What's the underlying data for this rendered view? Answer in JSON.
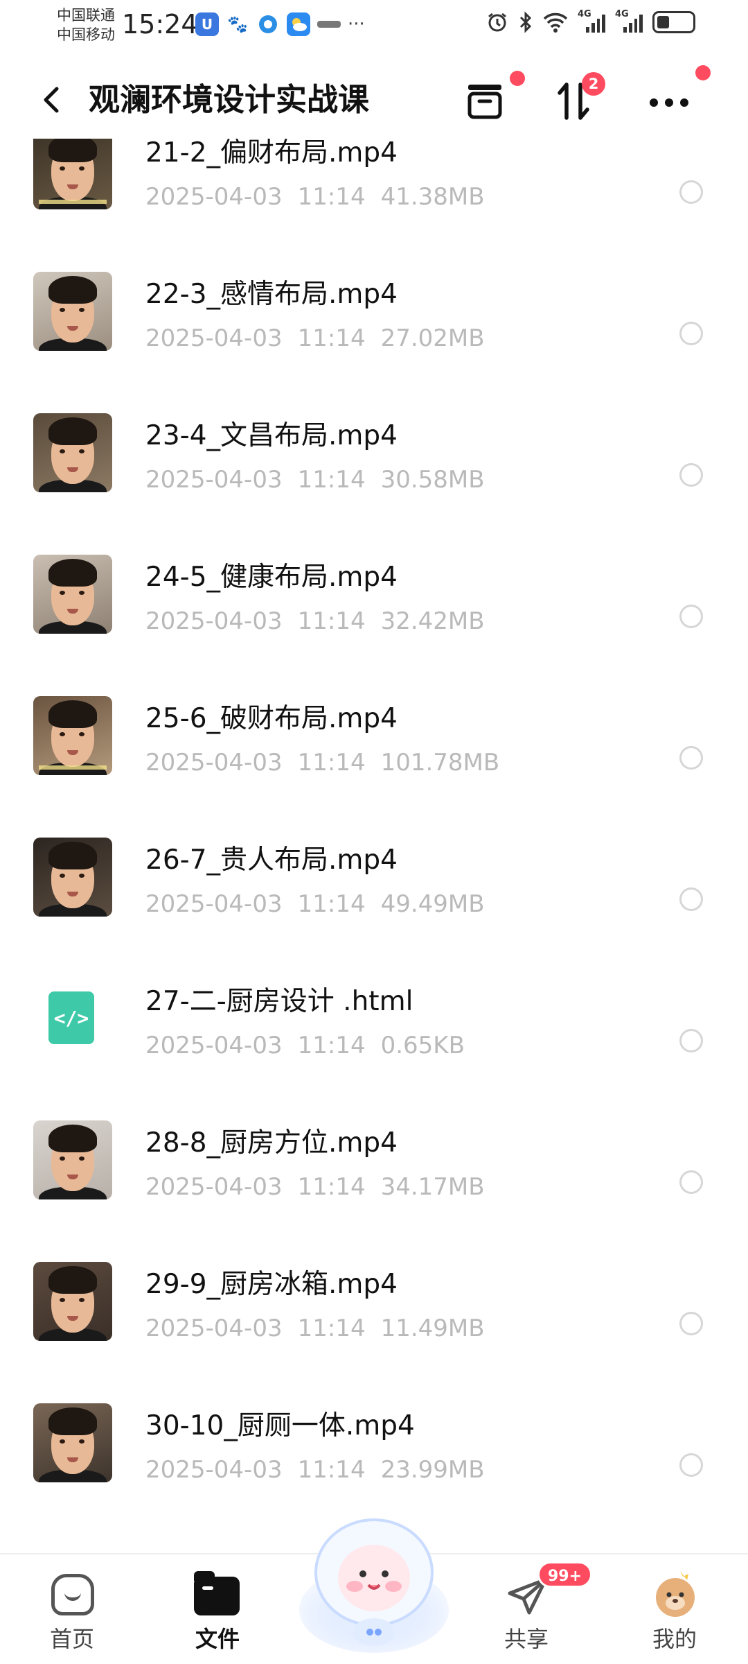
{
  "status_bar": {
    "carrier_1": "中国联通",
    "carrier_2": "中国移动",
    "time": "15:24",
    "signal_1": "4G",
    "signal_2": "4G",
    "battery_level": 0.35
  },
  "header": {
    "title": "观澜环境设计实战课",
    "transfer_badge": "2"
  },
  "files": [
    {
      "name": "21-2_偏财布局.mp4",
      "date": "2025-04-03",
      "time": "11:14",
      "size": "41.38MB",
      "type": "video"
    },
    {
      "name": "22-3_感情布局.mp4",
      "date": "2025-04-03",
      "time": "11:14",
      "size": "27.02MB",
      "type": "video"
    },
    {
      "name": "23-4_文昌布局.mp4",
      "date": "2025-04-03",
      "time": "11:14",
      "size": "30.58MB",
      "type": "video"
    },
    {
      "name": "24-5_健康布局.mp4",
      "date": "2025-04-03",
      "time": "11:14",
      "size": "32.42MB",
      "type": "video"
    },
    {
      "name": "25-6_破财布局.mp4",
      "date": "2025-04-03",
      "time": "11:14",
      "size": "101.78MB",
      "type": "video"
    },
    {
      "name": "26-7_贵人布局.mp4",
      "date": "2025-04-03",
      "time": "11:14",
      "size": "49.49MB",
      "type": "video"
    },
    {
      "name": "27-二-厨房设计 .html",
      "date": "2025-04-03",
      "time": "11:14",
      "size": "0.65KB",
      "type": "html",
      "icon_label": "</>"
    },
    {
      "name": "28-8_厨房方位.mp4",
      "date": "2025-04-03",
      "time": "11:14",
      "size": "34.17MB",
      "type": "video"
    },
    {
      "name": "29-9_厨房冰箱.mp4",
      "date": "2025-04-03",
      "time": "11:14",
      "size": "11.49MB",
      "type": "video"
    },
    {
      "name": "30-10_厨厕一体.mp4",
      "date": "2025-04-03",
      "time": "11:14",
      "size": "23.99MB",
      "type": "video"
    }
  ],
  "bottom_nav": {
    "home": "首页",
    "files": "文件",
    "share": "共享",
    "share_badge": "99+",
    "mine": "我的"
  },
  "colors": {
    "accent_red": "#ff4b5f",
    "html_icon": "#3ec9a8",
    "meta_text": "#b9b9b9"
  }
}
